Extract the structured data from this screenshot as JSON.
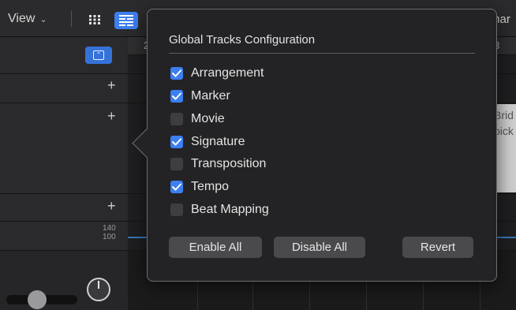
{
  "toolbar": {
    "view_label": "View",
    "view_chevron": "chevron-down-icon",
    "grid_icon": "grid-view-icon",
    "list_icon": "list-view-icon",
    "right_text": "mar"
  },
  "ruler": {
    "numbers": [
      "2",
      "3"
    ]
  },
  "track_header": {
    "tempo_values": [
      "140",
      "100"
    ],
    "plus_icon": "plus-icon"
  },
  "region": {
    "text_lines": [
      "Brid",
      "pick"
    ]
  },
  "popover": {
    "title": "Global Tracks Configuration",
    "options": [
      {
        "label": "Arrangement",
        "checked": true
      },
      {
        "label": "Marker",
        "checked": true
      },
      {
        "label": "Movie",
        "checked": false
      },
      {
        "label": "Signature",
        "checked": true
      },
      {
        "label": "Transposition",
        "checked": false
      },
      {
        "label": "Tempo",
        "checked": true
      },
      {
        "label": "Beat Mapping",
        "checked": false
      }
    ],
    "buttons": {
      "enable_all": "Enable All",
      "disable_all": "Disable All",
      "revert": "Revert"
    }
  },
  "colors": {
    "accent": "#3d7ff1",
    "popover_bg": "#232325",
    "popover_border": "#6e6e70"
  }
}
